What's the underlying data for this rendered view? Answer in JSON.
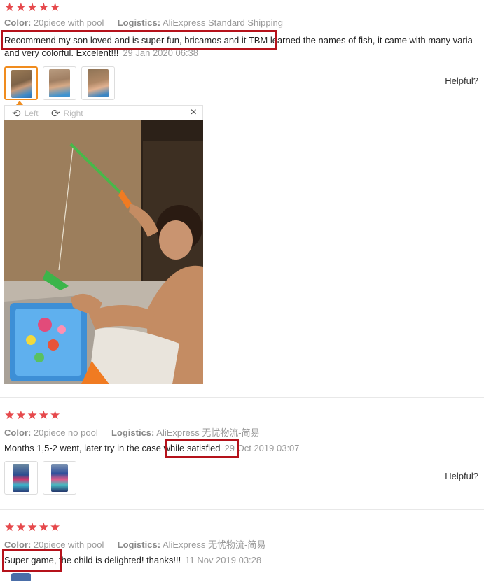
{
  "colors": {
    "star": "#e6494c",
    "highlight": "#b5121b",
    "active_thumb": "#f08c1e"
  },
  "reviews": [
    {
      "stars": "★★★★★",
      "color_label": "Color:",
      "color_value": "20piece with pool",
      "logistics_label": "Logistics:",
      "logistics_value": "AliExpress Standard Shipping",
      "text_line1": "Recommend my son loved and is super fun, bricamos and it TBM learned the names of fish, it came with many varia",
      "text_line2": "and very colorful. Excelent!!!",
      "date": "29 Jan 2020 06:38",
      "helpful": "Helpful?",
      "viewer": {
        "left_label": "Left",
        "right_label": "Right",
        "close": "×"
      }
    },
    {
      "stars": "★★★★★",
      "color_label": "Color:",
      "color_value": "20piece no pool",
      "logistics_label": "Logistics:",
      "logistics_value": "AliExpress 无忧物流-简易",
      "text": "Months 1,5-2 went, later try in the case while satisfied",
      "date": "29 Oct 2019 03:07",
      "helpful": "Helpful?"
    },
    {
      "stars": "★★★★★",
      "color_label": "Color:",
      "color_value": "20piece with pool",
      "logistics_label": "Logistics:",
      "logistics_value": "AliExpress 无忧物流-简易",
      "text": "Super game, the child is delighted! thanks!!!",
      "date": "11 Nov 2019 03:28"
    }
  ]
}
